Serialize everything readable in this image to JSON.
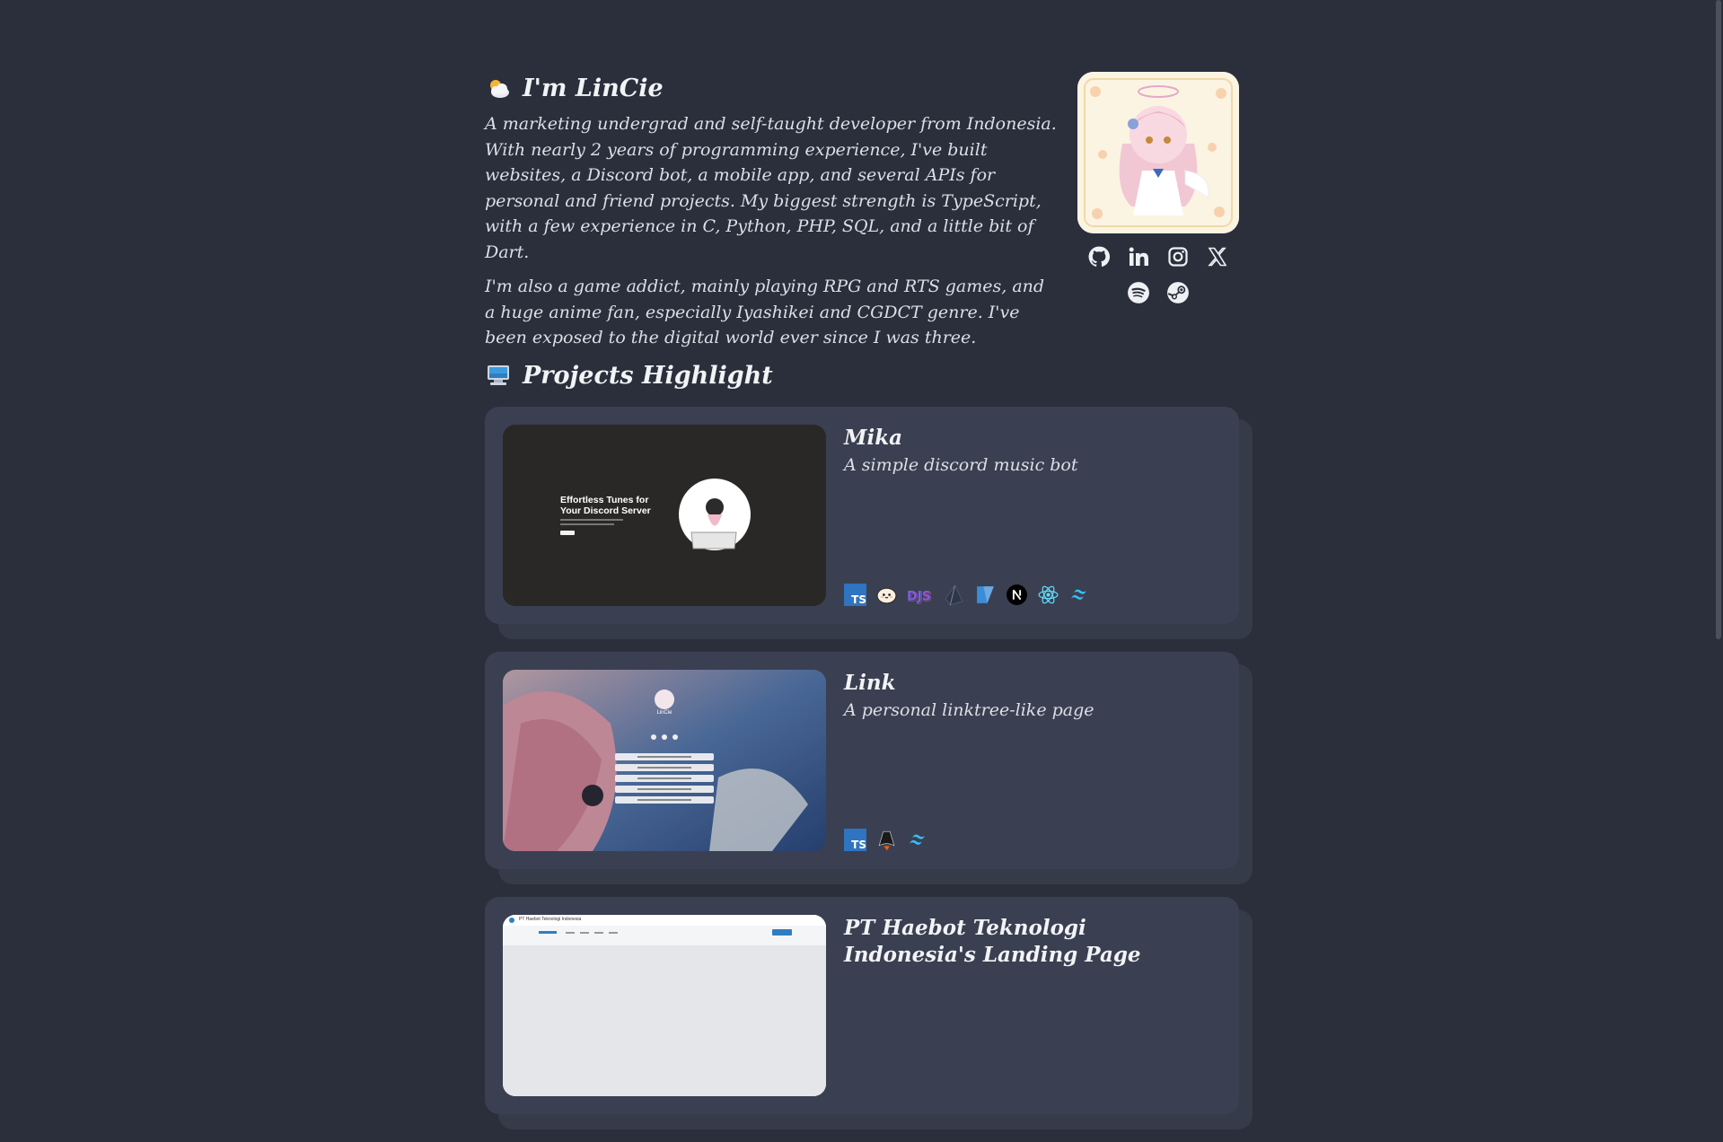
{
  "intro": {
    "title": "I'm LinCie",
    "paragraph1": "A marketing undergrad and self-taught developer from Indonesia. With nearly 2 years of programming experience, I've built websites, a Discord bot, a mobile app, and several APIs for personal and friend projects. My biggest strength is TypeScript, with a few experience in C, Python, PHP, SQL, and a little bit of Dart.",
    "paragraph2": "I'm also a game addict, mainly playing RPG and RTS games, and a huge anime fan, especially Iyashikei and CGDCT genre. I've been exposed to the digital world ever since I was three.",
    "icon": "cloud-sun-icon"
  },
  "socials": [
    "github-icon",
    "linkedin-icon",
    "instagram-icon",
    "x-icon",
    "spotify-icon",
    "steam-icon"
  ],
  "projects_section": {
    "title": "Projects Highlight",
    "icon": "computer-icon"
  },
  "projects": [
    {
      "title": "Mika",
      "description": "A simple discord music bot",
      "thumb_heading": "Effortless Tunes for Your Discord Server",
      "tech": [
        "typescript-icon",
        "bun-icon",
        "discordjs-icon",
        "prisma-icon",
        "drizzle-icon",
        "nextjs-icon",
        "react-icon",
        "tailwind-icon"
      ]
    },
    {
      "title": "Link",
      "description": "A personal linktree-like page",
      "thumb_heading": "LinCie",
      "tech": [
        "typescript-icon",
        "astro-icon",
        "tailwind-icon"
      ]
    },
    {
      "title": "PT Haebot Teknologi Indonesia's Landing Page",
      "description": "",
      "thumb_heading": "PT Haebot Teknologi Indonesia",
      "tech": []
    }
  ]
}
